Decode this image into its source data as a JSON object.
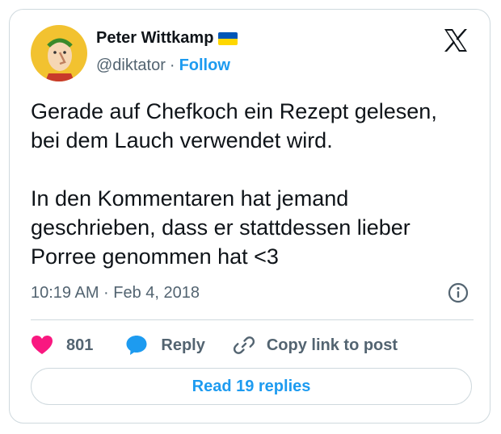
{
  "author": {
    "name": "Peter Wittkamp",
    "handle": "@diktator",
    "follow_label": "Follow",
    "separator": "·",
    "flag_icon": "ukraine-flag-icon",
    "avatar_icon": "caricature-avatar"
  },
  "platform_icon": "x-logo-icon",
  "tweet": {
    "lines_paragraph_1": [
      "Gerade auf Chefkoch ein Rezept gelesen,",
      "bei dem Lauch verwendet wird."
    ],
    "lines_paragraph_2": [
      "In den Kommentaren hat jemand",
      "geschrieben, dass er stattdessen lieber",
      "Porree genommen hat <3"
    ]
  },
  "meta": {
    "timestamp": "10:19 AM · Feb 4, 2018",
    "info_icon": "info-icon"
  },
  "actions": {
    "like_count": "801",
    "like_icon": "heart-icon",
    "reply_label": "Reply",
    "reply_icon": "speech-bubble-icon",
    "copy_label": "Copy link to post",
    "copy_icon": "link-icon"
  },
  "read_replies_label": "Read 19 replies",
  "colors": {
    "accent": "#1d9bf0",
    "like": "#f91880",
    "muted_text": "#536471",
    "border": "#cfd9de"
  }
}
